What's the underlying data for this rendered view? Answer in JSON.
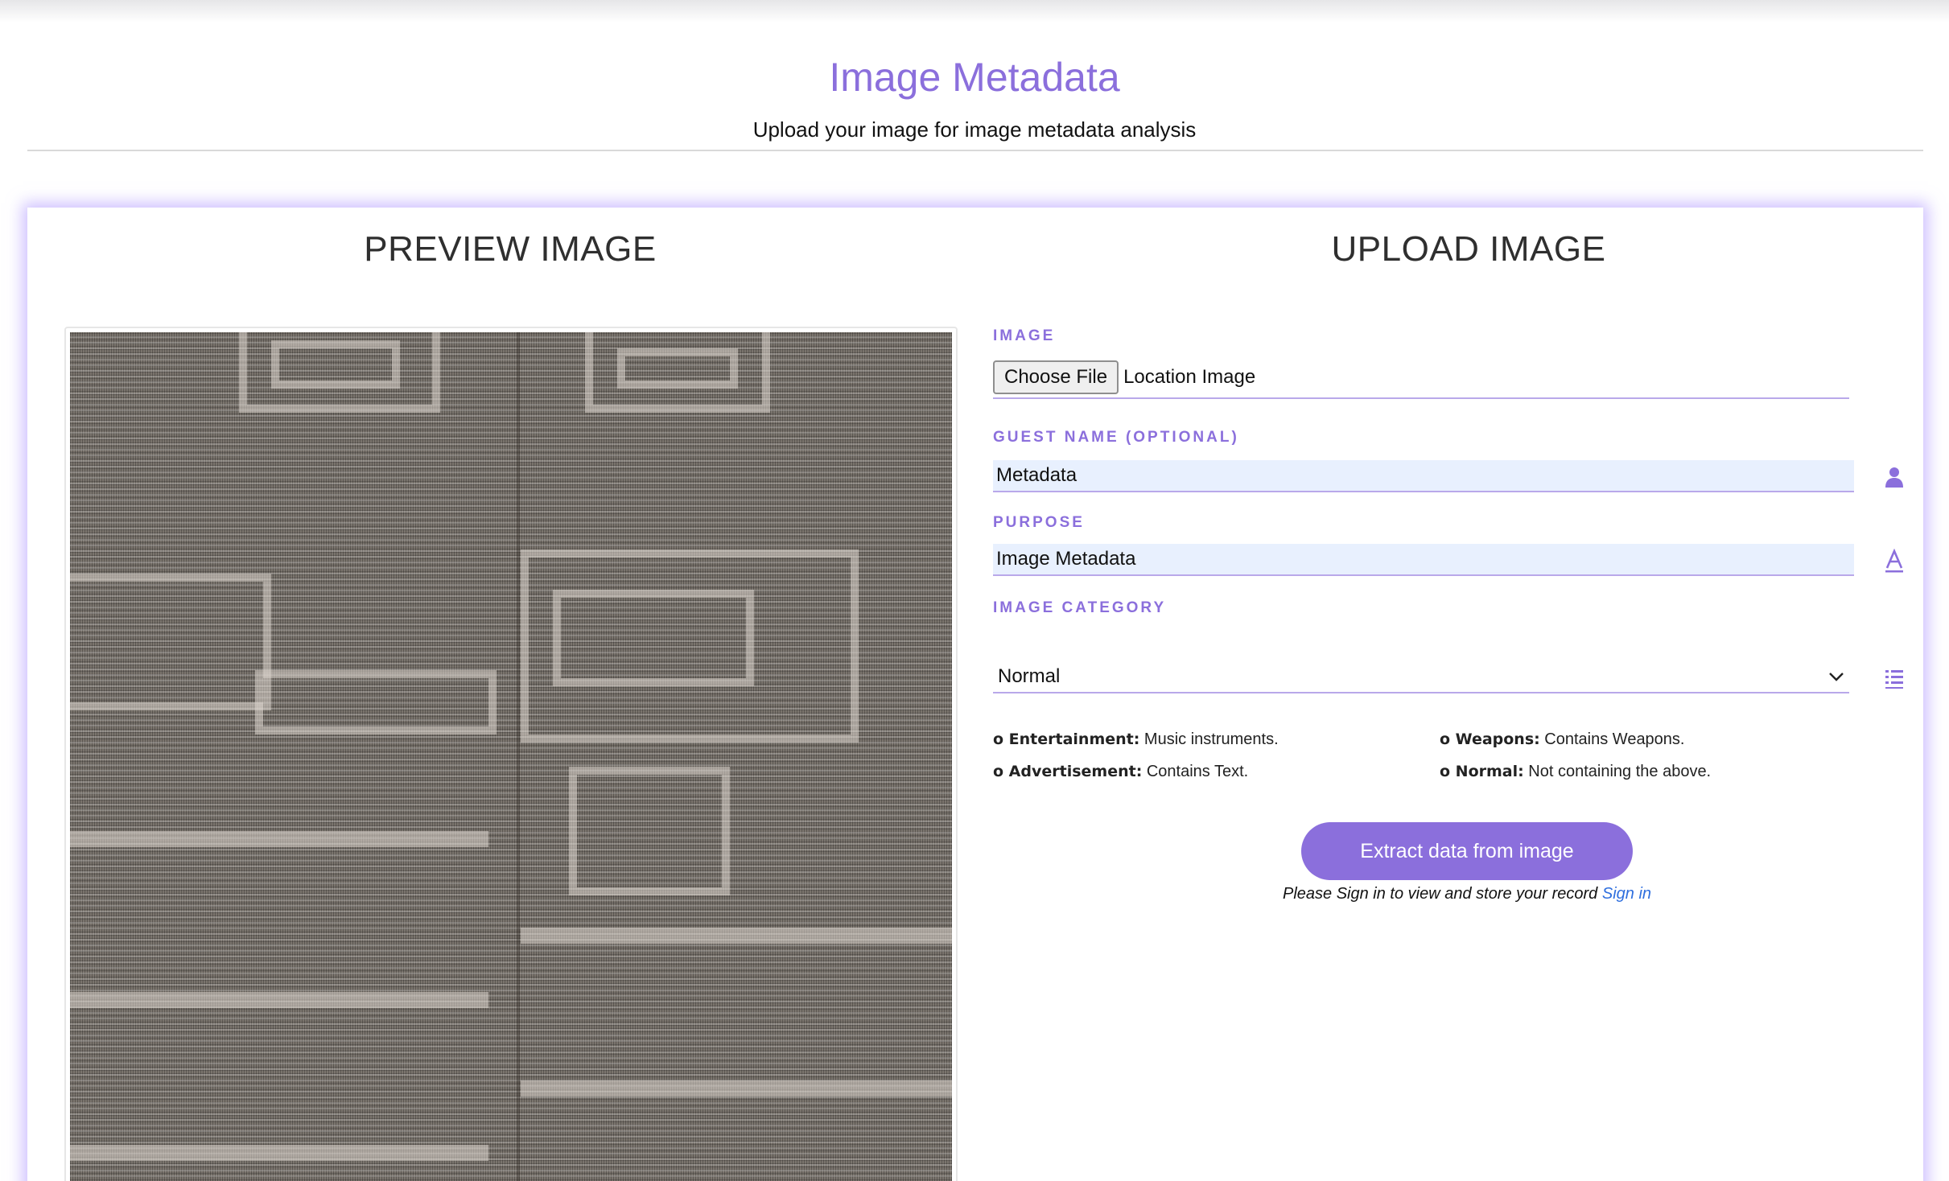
{
  "header": {
    "title": "Image Metadata",
    "subtitle": "Upload your image for image metadata analysis"
  },
  "preview": {
    "title": "PREVIEW IMAGE",
    "image_alt": "carpet-photo"
  },
  "upload": {
    "title": "UPLOAD IMAGE",
    "image_label": "IMAGE",
    "choose_file_label": "Choose File",
    "file_name": "Location Image",
    "guest_name_label": "GUEST NAME (OPTIONAL)",
    "guest_name_value": "Metadata",
    "guest_icon": "person-icon",
    "purpose_label": "PURPOSE",
    "purpose_value": "Image Metadata",
    "purpose_icon": "font-icon",
    "category_label": "IMAGE CATEGORY",
    "category_selected": "Normal",
    "category_icon": "list-icon",
    "legend": [
      {
        "name": "o Entertainment:",
        "desc": " Music instruments."
      },
      {
        "name": "o Weapons:",
        "desc": " Contains Weapons."
      },
      {
        "name": "o Advertisement:",
        "desc": " Contains Text."
      },
      {
        "name": "o Normal:",
        "desc": " Not containing the above."
      }
    ],
    "extract_button": "Extract data from image",
    "signin_note": "Please Sign in to view and store your record ",
    "signin_link": "Sign in"
  },
  "colors": {
    "accent": "#8b6fdc",
    "field_bg": "#e8f0fe",
    "link": "#2f6fde"
  }
}
